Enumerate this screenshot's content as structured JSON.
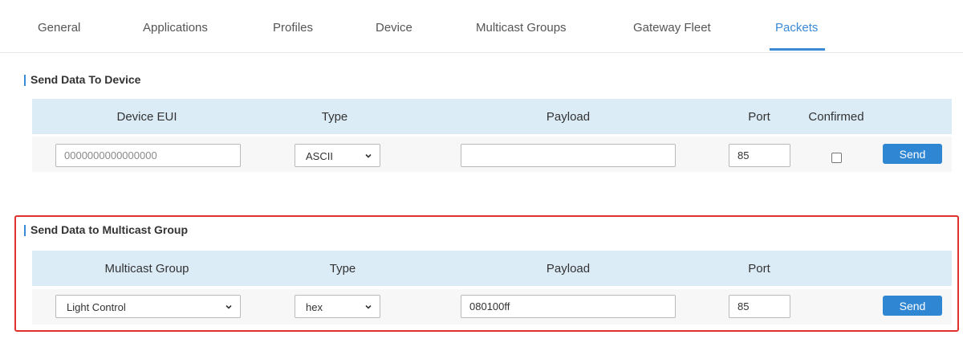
{
  "tabs": [
    {
      "label": "General"
    },
    {
      "label": "Applications"
    },
    {
      "label": "Profiles"
    },
    {
      "label": "Device"
    },
    {
      "label": "Multicast Groups"
    },
    {
      "label": "Gateway Fleet"
    },
    {
      "label": "Packets",
      "active": true
    }
  ],
  "device_section": {
    "title": "Send Data To Device",
    "headers": {
      "device_eui": "Device EUI",
      "type": "Type",
      "payload": "Payload",
      "port": "Port",
      "confirmed": "Confirmed"
    },
    "row": {
      "device_eui_placeholder": "0000000000000000",
      "type": "ASCII",
      "payload": "",
      "port": "85",
      "confirmed": false,
      "send_label": "Send"
    }
  },
  "multicast_section": {
    "title": "Send Data to Multicast Group",
    "headers": {
      "group": "Multicast Group",
      "type": "Type",
      "payload": "Payload",
      "port": "Port"
    },
    "row": {
      "group": "Light Control",
      "type": "hex",
      "payload": "080100ff",
      "port": "85",
      "send_label": "Send"
    }
  },
  "colors": {
    "accent": "#3b8ad6",
    "button": "#2f86d3",
    "header_bg": "#dcecf7",
    "row_bg": "#f7f7f7",
    "highlight": "#e0322d"
  }
}
